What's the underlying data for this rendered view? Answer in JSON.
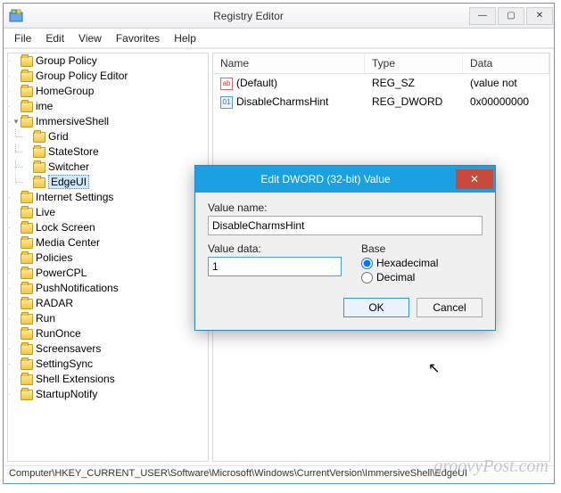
{
  "window": {
    "title": "Registry Editor"
  },
  "menu": {
    "file": "File",
    "edit": "Edit",
    "view": "View",
    "favorites": "Favorites",
    "help": "Help"
  },
  "tree": {
    "items": [
      {
        "label": "Group Policy"
      },
      {
        "label": "Group Policy Editor"
      },
      {
        "label": "HomeGroup"
      },
      {
        "label": "ime"
      },
      {
        "label": "ImmersiveShell",
        "expanded": true,
        "children": [
          {
            "label": "Grid"
          },
          {
            "label": "StateStore"
          },
          {
            "label": "Switcher"
          },
          {
            "label": "EdgeUI",
            "selected": true
          }
        ]
      },
      {
        "label": "Internet Settings"
      },
      {
        "label": "Live"
      },
      {
        "label": "Lock Screen"
      },
      {
        "label": "Media Center"
      },
      {
        "label": "Policies"
      },
      {
        "label": "PowerCPL"
      },
      {
        "label": "PushNotifications"
      },
      {
        "label": "RADAR"
      },
      {
        "label": "Run"
      },
      {
        "label": "RunOnce"
      },
      {
        "label": "Screensavers"
      },
      {
        "label": "SettingSync"
      },
      {
        "label": "Shell Extensions"
      },
      {
        "label": "StartupNotify"
      }
    ]
  },
  "list": {
    "headers": {
      "name": "Name",
      "type": "Type",
      "data": "Data"
    },
    "rows": [
      {
        "icon": "str",
        "name": "(Default)",
        "type": "REG_SZ",
        "data": "(value not"
      },
      {
        "icon": "dw",
        "name": "DisableCharmsHint",
        "type": "REG_DWORD",
        "data": "0x00000000"
      }
    ]
  },
  "statusbar": "Computer\\HKEY_CURRENT_USER\\Software\\Microsoft\\Windows\\CurrentVersion\\ImmersiveShell\\EdgeUI",
  "dialog": {
    "title": "Edit DWORD (32-bit) Value",
    "valueNameLabel": "Value name:",
    "valueName": "DisableCharmsHint",
    "valueDataLabel": "Value data:",
    "valueData": "1",
    "baseLabel": "Base",
    "hex": "Hexadecimal",
    "dec": "Decimal",
    "ok": "OK",
    "cancel": "Cancel"
  },
  "watermark": "groovyPost.com"
}
